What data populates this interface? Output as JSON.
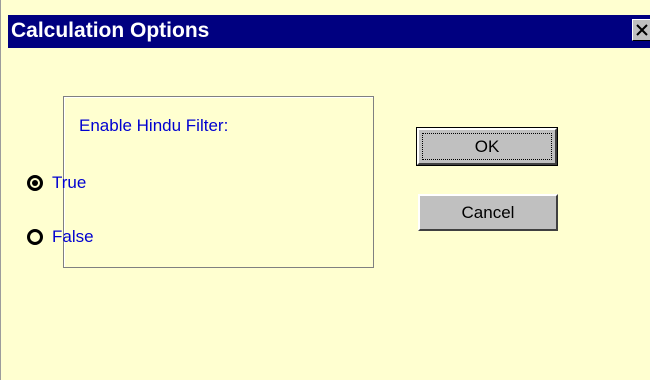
{
  "window": {
    "title": "Calculation Options",
    "close_icon": "close-icon"
  },
  "group": {
    "label": "Enable Hindu Filter:",
    "options": [
      {
        "label": "True",
        "selected": true
      },
      {
        "label": "False",
        "selected": false
      }
    ]
  },
  "buttons": {
    "ok_label": "OK",
    "cancel_label": "Cancel"
  },
  "colors": {
    "title_bar": "#000080",
    "dialog_background": "#ffffd0",
    "label_text": "#0000d0",
    "button_face": "#c0c0c0"
  }
}
